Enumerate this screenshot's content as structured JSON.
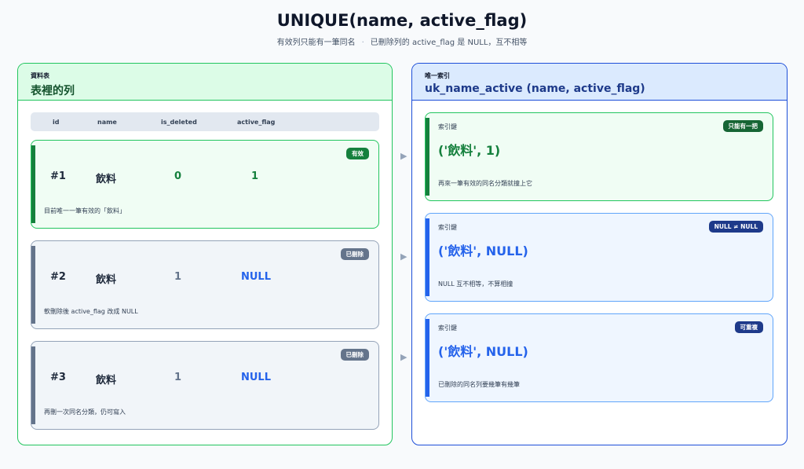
{
  "header": {
    "title": "UNIQUE(name, active_flag)",
    "subtitle_left": "有效列只能有一筆同名",
    "subtitle_sep": "·",
    "subtitle_right": "已刪除列的 active_flag 是 NULL，互不相等"
  },
  "table_panel": {
    "kicker": "資料表",
    "title": "表裡的列",
    "columns": [
      "id",
      "name",
      "is_deleted",
      "active_flag"
    ],
    "rows": [
      {
        "id": "#1",
        "name": "飲料",
        "is_deleted": "0",
        "active_flag": "1",
        "badge": "有效",
        "note": "目前唯一一筆有效的「飲料」"
      },
      {
        "id": "#2",
        "name": "飲料",
        "is_deleted": "1",
        "active_flag": "NULL",
        "badge": "已刪除",
        "note": "軟刪除後 active_flag 改成 NULL"
      },
      {
        "id": "#3",
        "name": "飲料",
        "is_deleted": "1",
        "active_flag": "NULL",
        "badge": "已刪除",
        "note": "再刪一次同名分類，仍可寫入"
      }
    ]
  },
  "index_panel": {
    "kicker": "唯一索引",
    "title": "uk_name_active (name, active_flag)",
    "keys": [
      {
        "label": "索引鍵",
        "value": "('飲料', 1)",
        "badge": "只能有一把",
        "note": "再來一筆有效的同名分類就撞上它"
      },
      {
        "label": "索引鍵",
        "value": "('飲料', NULL)",
        "badge": "NULL ≠ NULL",
        "note": "NULL 互不相等，不算相撞"
      },
      {
        "label": "索引鍵",
        "value": "('飲料', NULL)",
        "badge": "可重複",
        "note": "已刪除的同名列要幾筆有幾筆"
      }
    ]
  },
  "arrow_glyph": "▶",
  "colors": {
    "active_green": "#15803d",
    "deleted_grey": "#64748b",
    "null_blue": "#2563eb",
    "navy": "#1e3a8a"
  }
}
